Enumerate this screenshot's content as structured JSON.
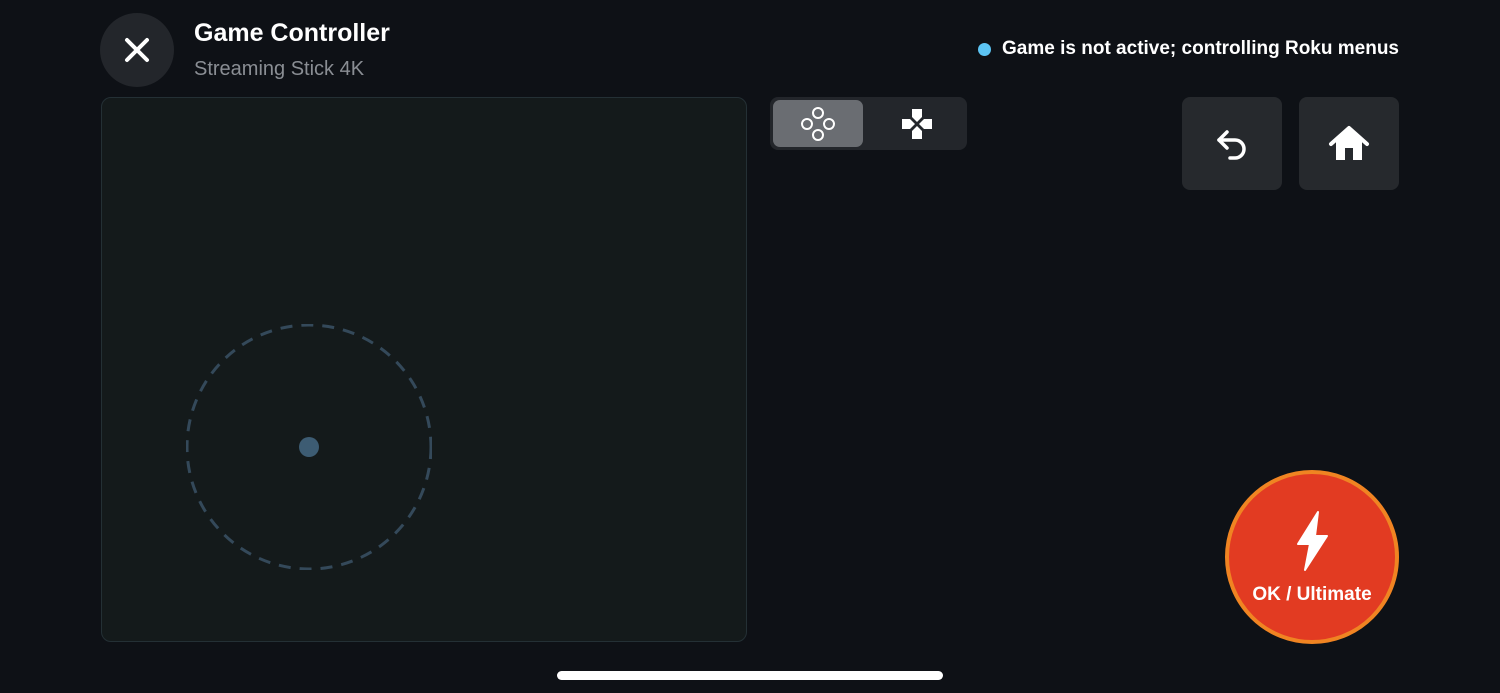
{
  "header": {
    "title": "Game Controller",
    "subtitle": "Streaming Stick 4K",
    "close_icon": "close-icon"
  },
  "status": {
    "text": "Game is not active; controlling Roku menus",
    "dot_color": "#5cc4f3",
    "icon": "status-dot-icon"
  },
  "touchpad": {
    "joystick_icon": "joystick-icon"
  },
  "mode_toggle": {
    "options": [
      {
        "icon": "face-buttons-icon",
        "selected": true
      },
      {
        "icon": "dpad-icon",
        "selected": false
      }
    ]
  },
  "actions": {
    "back_icon": "back-icon",
    "home_icon": "home-icon"
  },
  "ok_button": {
    "label": "OK / Ultimate",
    "icon": "lightning-icon",
    "fill_color": "#e23b22",
    "ring_color": "#f08422"
  },
  "colors": {
    "background": "#0e1116",
    "accent": "#5cc4f3"
  }
}
